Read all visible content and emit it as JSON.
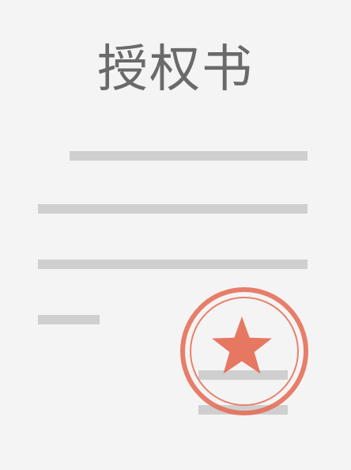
{
  "document": {
    "title": "授权书"
  },
  "colors": {
    "background": "#f5f4f4",
    "title_text": "#6a6a6a",
    "placeholder_line": "#cfcfcf",
    "seal": "#e46d55"
  },
  "icons": {
    "seal": "red-star-seal-icon"
  }
}
